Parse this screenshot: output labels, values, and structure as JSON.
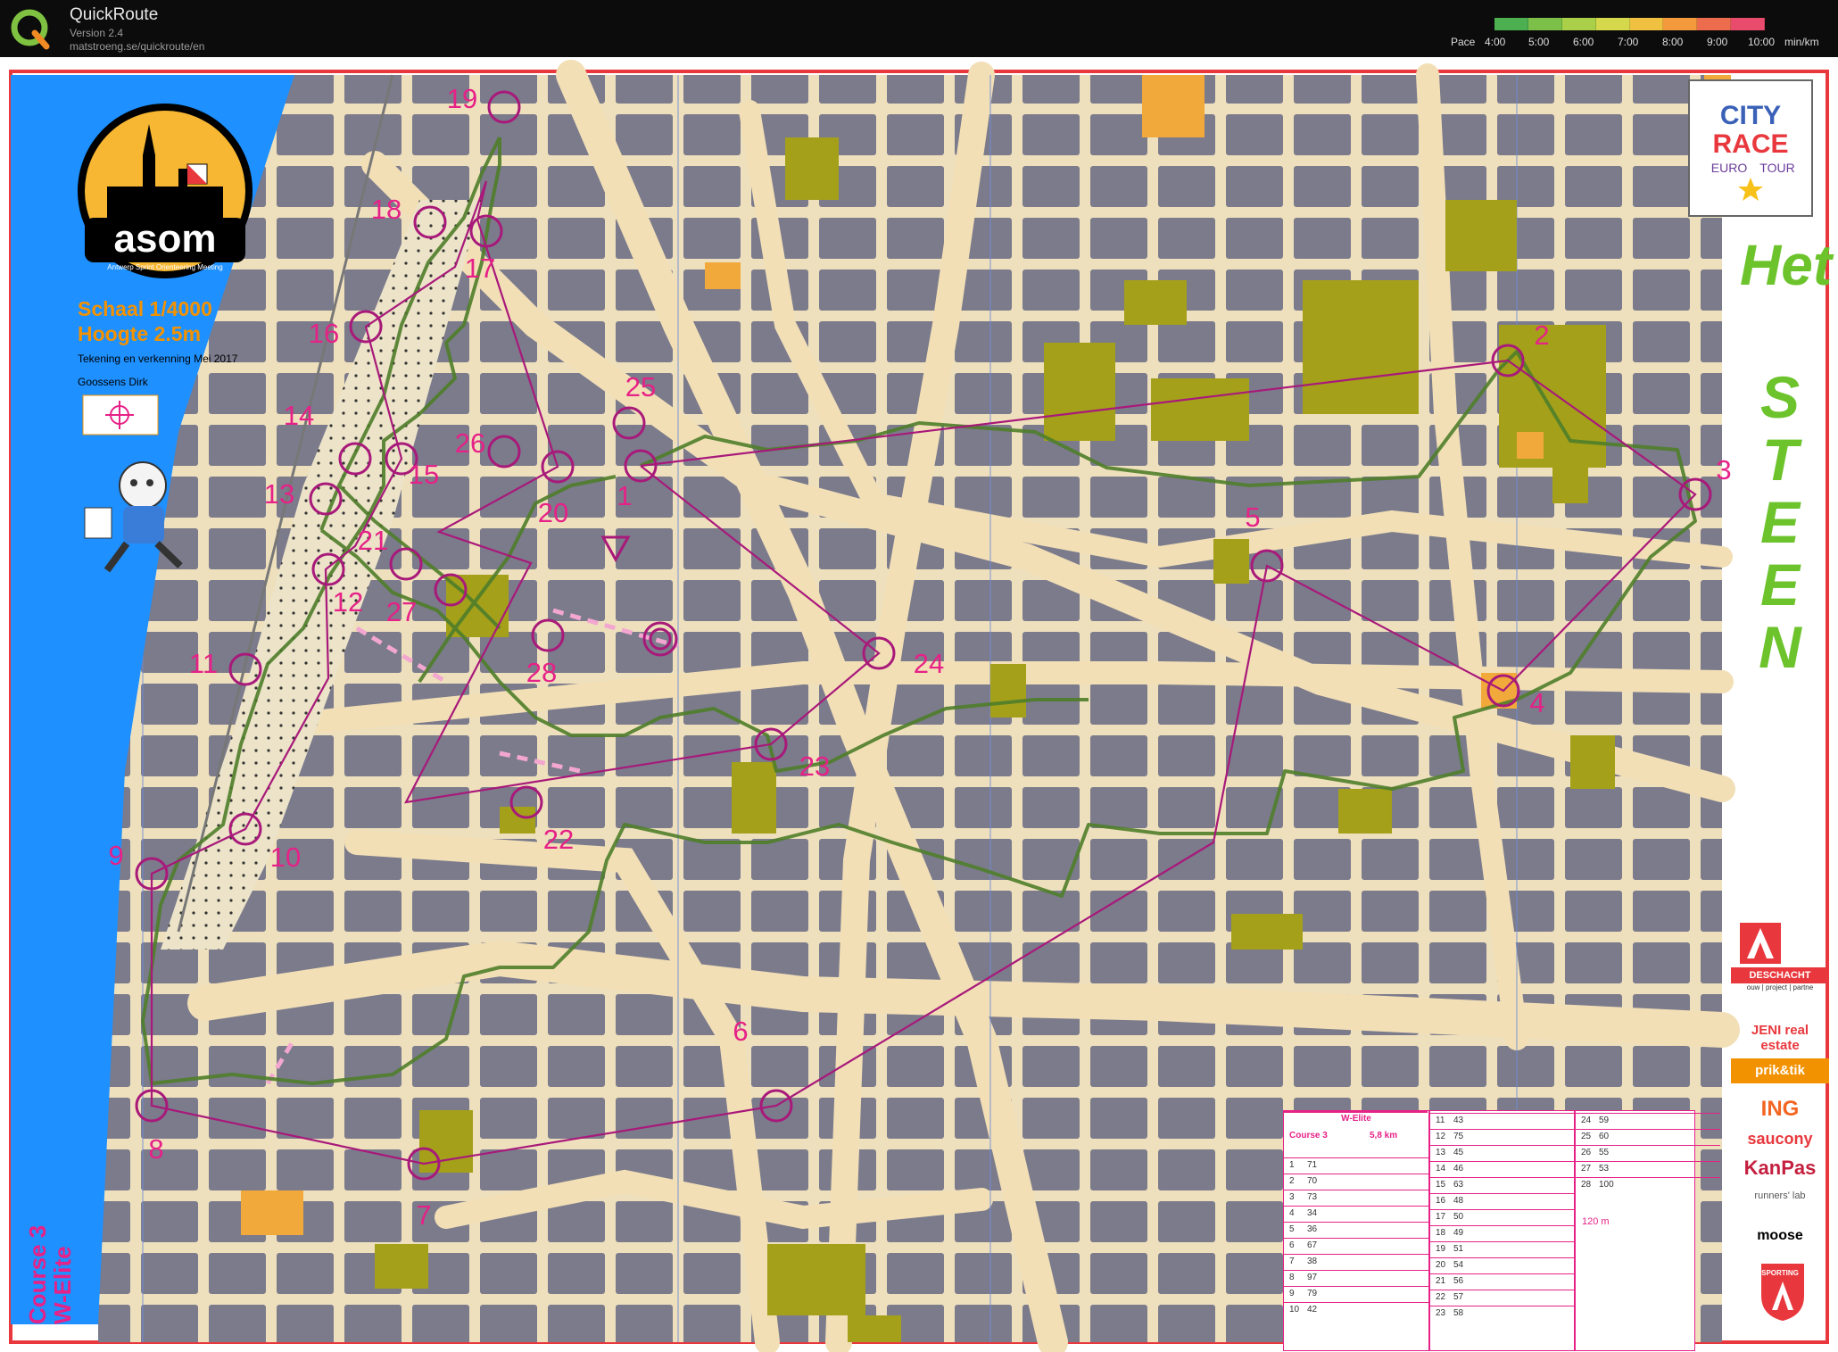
{
  "app": {
    "title": "QuickRoute",
    "version": "Version 2.4",
    "url": "matstroeng.se/quickroute/en"
  },
  "pace_legend": {
    "label": "Pace",
    "ticks": [
      "4:00",
      "5:00",
      "6:00",
      "7:00",
      "8:00",
      "9:00",
      "10:00"
    ],
    "unit": "min/km",
    "colors": [
      "#4caf50",
      "#7cc04a",
      "#a9d048",
      "#d4d84a",
      "#f0c040",
      "#f29a3c",
      "#ee6c4e",
      "#e84b6b"
    ]
  },
  "map": {
    "club_logo": "asom",
    "club_subtitle": "Antwerp Sprint Orienteering Meeting",
    "scale": "Schaal 1/4000",
    "contour": "Hoogte 2.5m",
    "drawing": "Tekening en verkenning Mei 2017",
    "author": "Goossens Dirk",
    "event_logo_lines": [
      "CITY",
      "RACE",
      "EURO",
      "TOUR"
    ],
    "title_word_1": "Het",
    "title_word_2": "STEEN",
    "course_name": "Course 3",
    "course_class": "W-Elite",
    "colors": {
      "river": "#1e90ff",
      "buildings": "#7d7d8c",
      "streets": "#f4e4c4",
      "route": "#5b8c2a",
      "course": "#e62187",
      "green_areas": "#a4a01a",
      "orange_areas": "#f2a93b"
    }
  },
  "controls": [
    {
      "num": "1"
    },
    {
      "num": "2"
    },
    {
      "num": "3"
    },
    {
      "num": "4"
    },
    {
      "num": "5"
    },
    {
      "num": "6"
    },
    {
      "num": "7"
    },
    {
      "num": "8"
    },
    {
      "num": "9"
    },
    {
      "num": "10"
    },
    {
      "num": "11"
    },
    {
      "num": "12"
    },
    {
      "num": "13"
    },
    {
      "num": "14"
    },
    {
      "num": "15"
    },
    {
      "num": "16"
    },
    {
      "num": "17"
    },
    {
      "num": "18"
    },
    {
      "num": "19"
    },
    {
      "num": "20"
    },
    {
      "num": "21"
    },
    {
      "num": "22"
    },
    {
      "num": "23"
    },
    {
      "num": "24"
    },
    {
      "num": "25"
    },
    {
      "num": "26"
    },
    {
      "num": "27"
    },
    {
      "num": "28"
    }
  ],
  "control_card": {
    "class": "W-Elite",
    "course": "Course 3",
    "length": "5,8 km",
    "rows_a": [
      {
        "n": "1",
        "code": "71"
      },
      {
        "n": "2",
        "code": "70"
      },
      {
        "n": "3",
        "code": "73"
      },
      {
        "n": "4",
        "code": "34"
      },
      {
        "n": "5",
        "code": "36"
      },
      {
        "n": "6",
        "code": "67"
      },
      {
        "n": "7",
        "code": "38"
      },
      {
        "n": "8",
        "code": "97"
      },
      {
        "n": "9",
        "code": "79"
      },
      {
        "n": "10",
        "code": "42"
      }
    ],
    "rows_b": [
      {
        "n": "11",
        "code": "43"
      },
      {
        "n": "12",
        "code": "75"
      },
      {
        "n": "13",
        "code": "45"
      },
      {
        "n": "14",
        "code": "46"
      },
      {
        "n": "15",
        "code": "63"
      },
      {
        "n": "16",
        "code": "48"
      },
      {
        "n": "17",
        "code": "50"
      },
      {
        "n": "18",
        "code": "49"
      },
      {
        "n": "19",
        "code": "51"
      },
      {
        "n": "20",
        "code": "54"
      },
      {
        "n": "21",
        "code": "56"
      },
      {
        "n": "22",
        "code": "57"
      },
      {
        "n": "23",
        "code": "58"
      }
    ],
    "rows_c": [
      {
        "n": "24",
        "code": "59"
      },
      {
        "n": "25",
        "code": "60"
      },
      {
        "n": "26",
        "code": "55"
      },
      {
        "n": "27",
        "code": "53"
      },
      {
        "n": "28",
        "code": "100"
      }
    ],
    "finish_distance": "120 m"
  },
  "sponsors": [
    {
      "name": "DESCHACHT",
      "sub": "ouw | project | partne"
    },
    {
      "name": "JENI real estate"
    },
    {
      "name": "prik&tik"
    },
    {
      "name": "ING"
    },
    {
      "name": "saucony"
    },
    {
      "name": "KanPas"
    },
    {
      "name": "runners' lab"
    },
    {
      "name": "moose"
    },
    {
      "name": "SPORTING"
    }
  ]
}
